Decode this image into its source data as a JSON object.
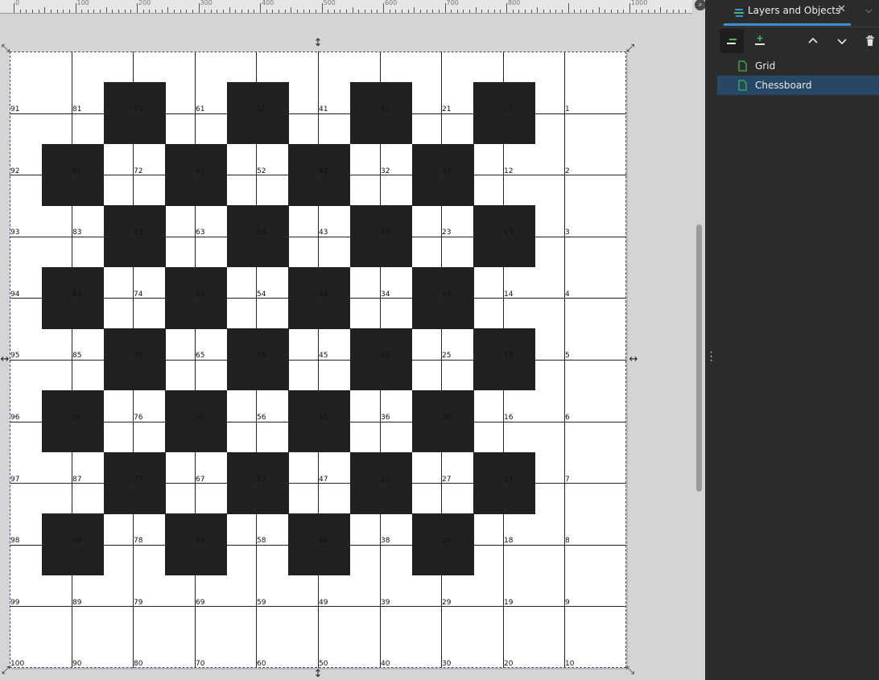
{
  "ruler": {
    "labels": [
      "0",
      "100",
      "200",
      "300",
      "400",
      "500",
      "600",
      "700",
      "800",
      "1000"
    ]
  },
  "canvas": {
    "board": {
      "columns": 10,
      "rows": 10,
      "square_color": "#212121",
      "numbering_rule": "label = 10*(9-col) + row + 1 (col 0..9 left to right, row 0..9 top to bottom)"
    }
  },
  "dock": {
    "tab_title": "Layers and Objects",
    "tab_close": "✕",
    "menu": "⌵",
    "toolbar": {
      "layers_mode": "layers-mode-icon",
      "add_layer": "add-layer-icon",
      "raise": "raise-icon",
      "lower": "lower-icon",
      "delete": "delete-icon"
    },
    "layers": [
      {
        "name": "Grid",
        "selected": false
      },
      {
        "name": "Chessboard",
        "selected": true
      }
    ]
  },
  "colors": {
    "accent": "#3d8fd8",
    "selection": "#264766",
    "file_icon": "#3fb34f"
  }
}
